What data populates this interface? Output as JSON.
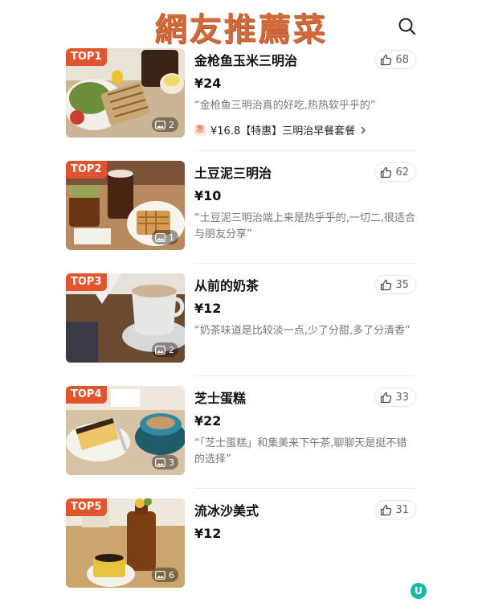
{
  "header": {
    "title": "網友推薦菜",
    "search_icon": "search-icon"
  },
  "colors": {
    "title": "#d06a3a",
    "rank_badge": "#e0542e",
    "deal_tag": "#e05a2e"
  },
  "items": [
    {
      "rank": "TOP1",
      "name": "金枪鱼玉米三明治",
      "likes": "68",
      "price": "¥24",
      "review": "“金枪鱼三明治真的好吃,热热软乎乎的”",
      "images": "2",
      "deal": {
        "tag": "惠",
        "text": "¥16.8【特惠】三明治早餐套餐"
      }
    },
    {
      "rank": "TOP2",
      "name": "土豆泥三明治",
      "likes": "62",
      "price": "¥10",
      "review": "“土豆泥三明治端上来是热乎乎的,一切二,很适合与朋友分享”",
      "images": "1"
    },
    {
      "rank": "TOP3",
      "name": "从前的奶茶",
      "likes": "35",
      "price": "¥12",
      "review": "“奶茶味道是比较淡一点,少了分甜,多了分清香”",
      "images": "2"
    },
    {
      "rank": "TOP4",
      "name": "芝士蛋糕",
      "likes": "33",
      "price": "¥22",
      "review": "“「芝士蛋糕」和集美来下午茶,聊聊天是挺不错的选择”",
      "images": "3"
    },
    {
      "rank": "TOP5",
      "name": "流冰沙美式",
      "likes": "31",
      "price": "¥12",
      "review": "",
      "images": "6"
    }
  ],
  "watermark": "U"
}
